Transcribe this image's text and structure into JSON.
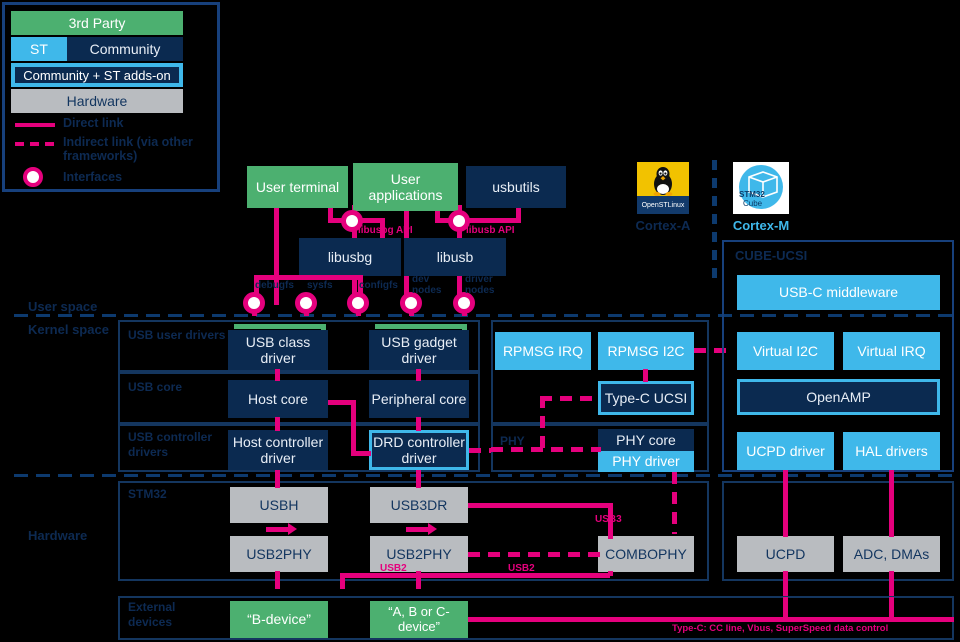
{
  "legend": {
    "third_party": "3rd Party",
    "st": "ST",
    "community": "Community",
    "community_st": "Community + ST adds-on",
    "hardware": "Hardware",
    "direct_link": "Direct link",
    "indirect_link": "Indirect link (via other frameworks)",
    "interfaces": "Interfaces",
    "colors": {
      "third_party": "#4cb070",
      "st": "#3fb8ea",
      "community": "#0b2a50",
      "hardware": "#b9bcc0",
      "link": "#e5007d",
      "outline": "#14365f"
    }
  },
  "spaces": {
    "user": "User space",
    "kernel": "Kernel space",
    "hardware": "Hardware"
  },
  "userspace": {
    "user_terminal": "User terminal",
    "user_applications": "User applications",
    "usbutils": "usbutils",
    "libusbg": "libusbg",
    "libusb": "libusb",
    "libusbg_api": "libusbg API",
    "libusb_api": "libusb API",
    "interfaces": [
      "debugfs",
      "sysfs",
      "configfs",
      "dev nodes",
      "driver nodes"
    ]
  },
  "logos": {
    "linux_name": "OpenSTLinux",
    "linux_caption": "Cortex-A",
    "cube_name_a": "STM32",
    "cube_name_b": "Cube",
    "cube_caption": "Cortex-M"
  },
  "kernel": {
    "rows": [
      "USB user drivers",
      "USB core",
      "USB controller drivers"
    ],
    "phy_row": "PHY",
    "usb_class_driver": "USB class driver",
    "usb_gadget_driver": "USB gadget driver",
    "host_core": "Host core",
    "peripheral_core": "Peripheral core",
    "host_controller_driver": "Host controller driver",
    "drd_controller_driver": "DRD controller driver",
    "rpmsg_irq": "RPMSG IRQ",
    "rpmsg_i2c": "RPMSG I2C",
    "typec_ucsi": "Type-C UCSI",
    "phy_core": "PHY core",
    "phy_driver": "PHY driver"
  },
  "cube_ucsi": {
    "title": "CUBE-UCSI",
    "usbc_middleware": "USB-C middleware",
    "virtual_i2c": "Virtual I2C",
    "virtual_irq": "Virtual IRQ",
    "openamp": "OpenAMP",
    "ucpd_driver": "UCPD driver",
    "hal_drivers": "HAL drivers"
  },
  "hardware": {
    "row_label": "STM32",
    "usbh": "USBH",
    "usb3dr": "USB3DR",
    "usb2phy_left": "USB2PHY",
    "usb2phy_mid": "USB2PHY",
    "combophy": "COMBOPHY",
    "ucpd": "UCPD",
    "adc_dmas": "ADC, DMAs",
    "link_usb3": "USB3",
    "link_usb2_a": "USB2",
    "link_usb2_b": "USB2"
  },
  "external": {
    "row_label": "External devices",
    "b_device": "“B-device”",
    "abc_device": "“A, B or C-device”",
    "typec_note": "Type-C: CC line, Vbus, SuperSpeed data control"
  }
}
